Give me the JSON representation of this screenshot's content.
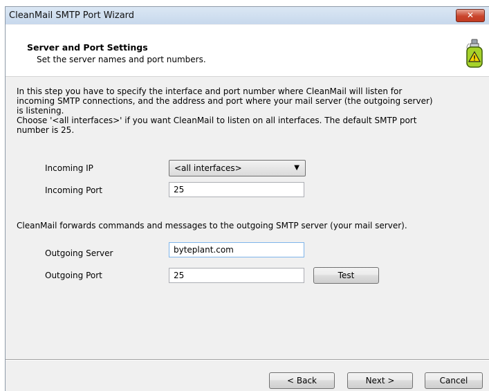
{
  "window": {
    "title": "CleanMail SMTP Port Wizard",
    "close_glyph": "✕"
  },
  "header": {
    "title": "Server and Port Settings",
    "subtitle": "Set the server names and port numbers.",
    "icon": "cleanmail-spray-warning-icon"
  },
  "description": {
    "line1": "In this step you have to specify the interface and port number where CleanMail will listen for",
    "line2": "incoming SMTP connections, and the address and port where your mail server (the outgoing server)",
    "line3": "is listening.",
    "line4": "Choose '<all interfaces>' if you want CleanMail to listen on all interfaces. The default SMTP port",
    "line5": "number is 25."
  },
  "incoming": {
    "ip_label": "Incoming IP",
    "ip_value": "<all interfaces>",
    "port_label": "Incoming Port",
    "port_value": "25"
  },
  "forward_note": "CleanMail forwards commands and messages to the outgoing SMTP server (your mail server).",
  "outgoing": {
    "server_label": "Outgoing Server",
    "server_value": "byteplant.com",
    "port_label": "Outgoing Port",
    "port_value": "25",
    "test_label": "Test"
  },
  "footer": {
    "back_label": "< Back",
    "next_label": "Next >",
    "cancel_label": "Cancel"
  }
}
